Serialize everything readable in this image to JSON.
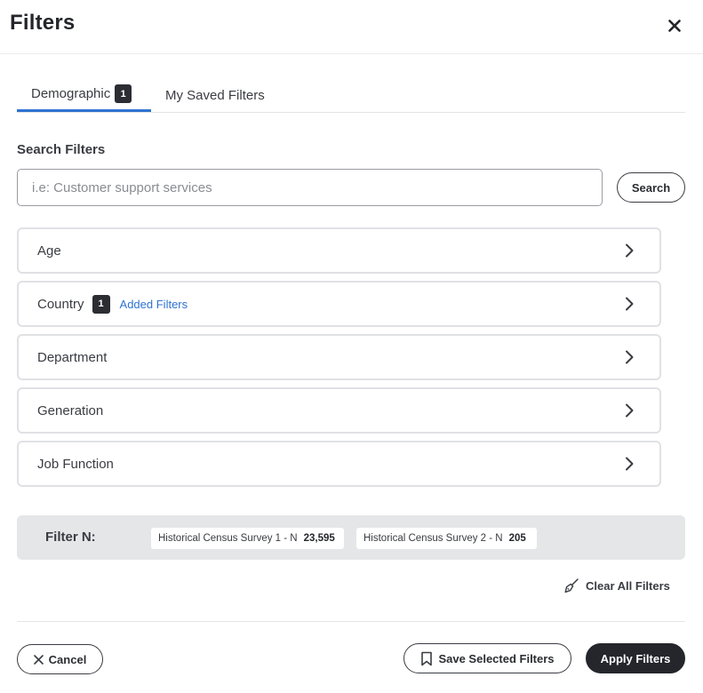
{
  "header": {
    "title": "Filters",
    "close_icon": "close-icon"
  },
  "tabs": [
    {
      "label": "Demographic",
      "badge": "1",
      "active": true
    },
    {
      "label": "My Saved Filters",
      "active": false
    }
  ],
  "search": {
    "label": "Search Filters",
    "placeholder": "i.e: Customer support services",
    "value": "",
    "button_label": "Search"
  },
  "filters": [
    {
      "label": "Age"
    },
    {
      "label": "Country",
      "badge": "1",
      "added_label": "Added Filters"
    },
    {
      "label": "Department"
    },
    {
      "label": "Generation"
    },
    {
      "label": "Job Function"
    }
  ],
  "filter_n": {
    "label": "Filter N:",
    "chips": [
      {
        "label": "Historical Census Survey 1 - N",
        "value": "23,595"
      },
      {
        "label": "Historical Census Survey 2 - N",
        "value": "205"
      }
    ]
  },
  "clear_all_label": "Clear All Filters",
  "footer": {
    "cancel_label": "Cancel",
    "save_label": "Save Selected Filters",
    "apply_label": "Apply Filters"
  },
  "colors": {
    "accent": "#2f73d0",
    "dark": "#24262b",
    "panel": "#e5e6e8"
  }
}
